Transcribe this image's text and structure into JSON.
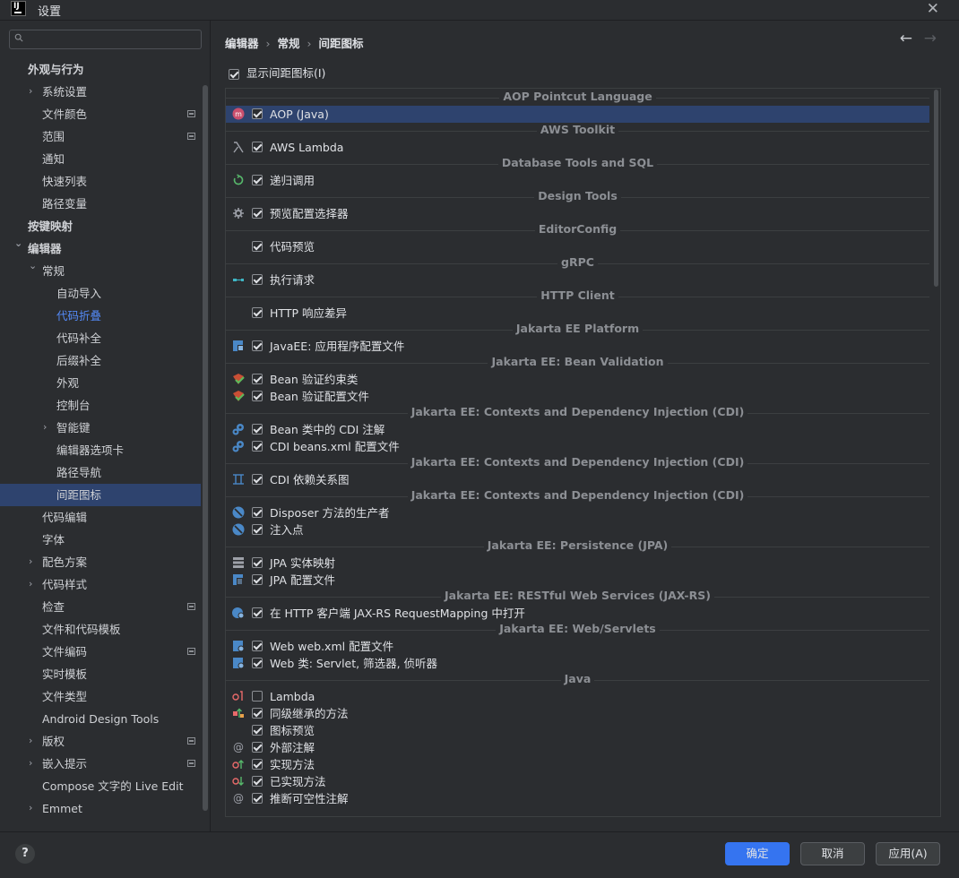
{
  "window": {
    "title": "设置",
    "logo": "IJ"
  },
  "sidebar": {
    "search_placeholder": "",
    "items": [
      {
        "label": "外观与行为",
        "bold": true,
        "indent": 0,
        "chevron": "none"
      },
      {
        "label": "系统设置",
        "indent": 1,
        "chevron": "right"
      },
      {
        "label": "文件颜色",
        "indent": 1,
        "badge": true
      },
      {
        "label": "范围",
        "indent": 1,
        "badge": true
      },
      {
        "label": "通知",
        "indent": 1
      },
      {
        "label": "快速列表",
        "indent": 1
      },
      {
        "label": "路径变量",
        "indent": 1
      },
      {
        "label": "按键映射",
        "bold": true,
        "indent": 0
      },
      {
        "label": "编辑器",
        "bold": true,
        "indent": 0,
        "chevron": "down"
      },
      {
        "label": "常规",
        "indent": 1,
        "chevron": "down"
      },
      {
        "label": "自动导入",
        "indent": 2
      },
      {
        "label": "代码折叠",
        "indent": 2,
        "active": true
      },
      {
        "label": "代码补全",
        "indent": 2
      },
      {
        "label": "后缀补全",
        "indent": 2
      },
      {
        "label": "外观",
        "indent": 2
      },
      {
        "label": "控制台",
        "indent": 2
      },
      {
        "label": "智能键",
        "indent": 2,
        "chevron": "right"
      },
      {
        "label": "编辑器选项卡",
        "indent": 2
      },
      {
        "label": "路径导航",
        "indent": 2
      },
      {
        "label": "间距图标",
        "indent": 2,
        "selected": true
      },
      {
        "label": "代码编辑",
        "indent": 1
      },
      {
        "label": "字体",
        "indent": 1
      },
      {
        "label": "配色方案",
        "indent": 1,
        "chevron": "right"
      },
      {
        "label": "代码样式",
        "indent": 1,
        "chevron": "right"
      },
      {
        "label": "检查",
        "indent": 1,
        "badge": true
      },
      {
        "label": "文件和代码模板",
        "indent": 1
      },
      {
        "label": "文件编码",
        "indent": 1,
        "badge": true
      },
      {
        "label": "实时模板",
        "indent": 1
      },
      {
        "label": "文件类型",
        "indent": 1
      },
      {
        "label": "Android Design Tools",
        "indent": 1
      },
      {
        "label": "版权",
        "indent": 1,
        "chevron": "right",
        "badge": true
      },
      {
        "label": "嵌入提示",
        "indent": 1,
        "chevron": "right",
        "badge": true
      },
      {
        "label": "Compose 文字的 Live Edit",
        "indent": 1
      },
      {
        "label": "Emmet",
        "indent": 1,
        "chevron": "right"
      }
    ]
  },
  "breadcrumb": [
    "编辑器",
    "常规",
    "间距图标"
  ],
  "show_gutter": {
    "label": "显示间距图标(I)",
    "checked": true
  },
  "rows": [
    {
      "type": "group",
      "title": "AOP Pointcut Language"
    },
    {
      "type": "opt",
      "label": "AOP (Java)",
      "icon": "aop-icon",
      "checked": true,
      "selected": true
    },
    {
      "type": "group",
      "title": "AWS Toolkit"
    },
    {
      "type": "opt",
      "label": "AWS Lambda",
      "icon": "lambda-icon",
      "checked": true
    },
    {
      "type": "group",
      "title": "Database Tools and SQL"
    },
    {
      "type": "opt",
      "label": "递归调用",
      "icon": "recursive-call-icon",
      "checked": true
    },
    {
      "type": "group",
      "title": "Design Tools"
    },
    {
      "type": "opt",
      "label": "预览配置选择器",
      "icon": "gear-icon",
      "checked": true
    },
    {
      "type": "group",
      "title": "EditorConfig"
    },
    {
      "type": "opt",
      "label": "代码预览",
      "icon": "",
      "checked": true
    },
    {
      "type": "group",
      "title": "gRPC"
    },
    {
      "type": "opt",
      "label": "执行请求",
      "icon": "grpc-request-icon",
      "checked": true
    },
    {
      "type": "group",
      "title": "HTTP Client"
    },
    {
      "type": "opt",
      "label": "HTTP 响应差异",
      "icon": "",
      "checked": true
    },
    {
      "type": "group",
      "title": "Jakarta EE Platform"
    },
    {
      "type": "opt",
      "label": "JavaEE: 应用程序配置文件",
      "icon": "javaee-config-icon",
      "checked": true
    },
    {
      "type": "group",
      "title": "Jakarta EE: Bean Validation"
    },
    {
      "type": "opt",
      "label": "Bean 验证约束类",
      "icon": "bean-validation-icon",
      "checked": true
    },
    {
      "type": "opt",
      "label": "Bean 验证配置文件",
      "icon": "bean-validation-icon",
      "checked": true
    },
    {
      "type": "group",
      "title": "Jakarta EE: Contexts and Dependency Injection (CDI)"
    },
    {
      "type": "opt",
      "label": "Bean 类中的 CDI 注解",
      "icon": "cdi-icon",
      "checked": true
    },
    {
      "type": "opt",
      "label": "CDI beans.xml 配置文件",
      "icon": "cdi-icon",
      "checked": true
    },
    {
      "type": "group",
      "title": "Jakarta EE: Contexts and Dependency Injection (CDI)"
    },
    {
      "type": "opt",
      "label": "CDI 依赖关系图",
      "icon": "dependency-graph-icon",
      "checked": true
    },
    {
      "type": "group",
      "title": "Jakarta EE: Contexts and Dependency Injection (CDI)"
    },
    {
      "type": "opt",
      "label": "Disposer 方法的生产者",
      "icon": "disposer-icon",
      "checked": true
    },
    {
      "type": "opt",
      "label": "注入点",
      "icon": "injection-point-icon",
      "checked": true
    },
    {
      "type": "group",
      "title": "Jakarta EE: Persistence (JPA)"
    },
    {
      "type": "opt",
      "label": "JPA 实体映射",
      "icon": "jpa-entity-icon",
      "checked": true
    },
    {
      "type": "opt",
      "label": "JPA 配置文件",
      "icon": "jpa-config-icon",
      "checked": true
    },
    {
      "type": "group",
      "title": "Jakarta EE: RESTful Web Services (JAX-RS)"
    },
    {
      "type": "opt",
      "label": "在 HTTP 客户端 JAX-RS RequestMapping 中打开",
      "icon": "jaxrs-icon",
      "checked": true
    },
    {
      "type": "group",
      "title": "Jakarta EE: Web/Servlets"
    },
    {
      "type": "opt",
      "label": "Web web.xml 配置文件",
      "icon": "web-xml-icon",
      "checked": true
    },
    {
      "type": "opt",
      "label": "Web 类: Servlet, 筛选器, 侦听器",
      "icon": "servlet-icon",
      "checked": true
    },
    {
      "type": "group",
      "title": "Java"
    },
    {
      "type": "opt",
      "label": "Lambda",
      "icon": "java-lambda-icon",
      "checked": false
    },
    {
      "type": "opt",
      "label": "同级继承的方法",
      "icon": "sibling-inherit-icon",
      "checked": true
    },
    {
      "type": "opt",
      "label": "图标预览",
      "icon": "",
      "checked": true
    },
    {
      "type": "opt",
      "label": "外部注解",
      "icon": "at-icon",
      "checked": true
    },
    {
      "type": "opt",
      "label": "实现方法",
      "icon": "implementing-icon",
      "checked": true
    },
    {
      "type": "opt",
      "label": "已实现方法",
      "icon": "implemented-icon",
      "checked": true
    },
    {
      "type": "opt",
      "label": "推断可空性注解",
      "icon": "at-icon",
      "checked": true
    }
  ],
  "footer": {
    "help": "?",
    "ok": "确定",
    "cancel": "取消",
    "apply": "应用(A)"
  },
  "colors": {
    "accent": "#3574f0",
    "selection": "#2e436e",
    "link": "#548af7",
    "background": "#2b2d30"
  }
}
